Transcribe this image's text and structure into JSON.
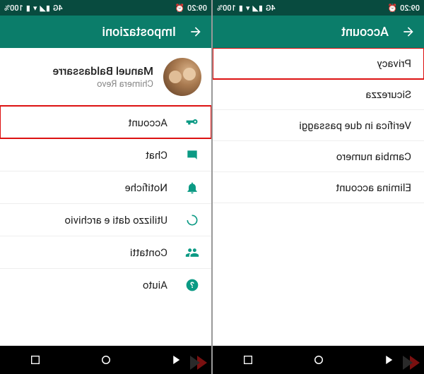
{
  "colors": {
    "brand": "#0b7d6a",
    "brandDark": "#084b3f",
    "accent": "#0b9a84",
    "highlight": "#d11"
  },
  "statusbar": {
    "time": "09:20",
    "network_label": "4G",
    "battery_text": "100%",
    "icons": [
      "alarm",
      "wifi",
      "signal",
      "battery"
    ]
  },
  "navbar": {
    "buttons": [
      "back-triangle",
      "home-circle",
      "recents-square"
    ]
  },
  "left_screen": {
    "appbar_title": "Impostazioni",
    "profile": {
      "name": "Manuel Baldassarre",
      "subtitle": "Chimera Revo"
    },
    "items": [
      {
        "icon": "key",
        "label": "Account",
        "highlighted": true
      },
      {
        "icon": "chat",
        "label": "Chat",
        "highlighted": false
      },
      {
        "icon": "bell",
        "label": "Notifiche",
        "highlighted": false
      },
      {
        "icon": "data",
        "label": "Utilizzo dati e archivio",
        "highlighted": false
      },
      {
        "icon": "contacts",
        "label": "Contatti",
        "highlighted": false
      },
      {
        "icon": "help",
        "label": "Aiuto",
        "highlighted": false
      }
    ]
  },
  "right_screen": {
    "appbar_title": "Account",
    "items": [
      {
        "label": "Privacy",
        "highlighted": true
      },
      {
        "label": "Sicurezza",
        "highlighted": false
      },
      {
        "label": "Verifica in due passaggi",
        "highlighted": false
      },
      {
        "label": "Cambia numero",
        "highlighted": false
      },
      {
        "label": "Elimina account",
        "highlighted": false
      }
    ]
  }
}
